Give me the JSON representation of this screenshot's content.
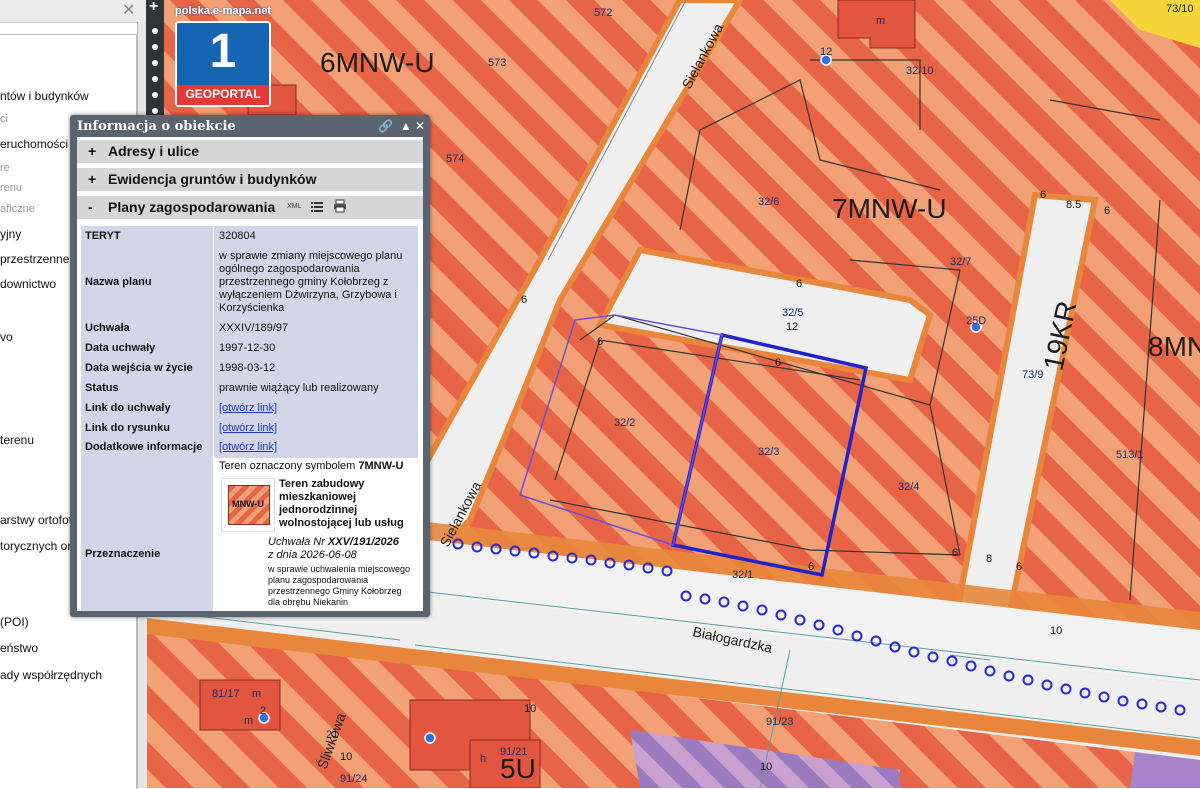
{
  "left_panel": {
    "close_glyph": "✕",
    "items": [
      {
        "label": "ntów i budynków",
        "dim": false
      },
      {
        "label": "ci",
        "dim": true
      },
      {
        "label": "eruchomości",
        "dim": false
      },
      {
        "label": "re",
        "dim": true
      },
      {
        "label": "renu",
        "dim": true
      },
      {
        "label": "aficzne",
        "dim": true
      },
      {
        "label": "yjny",
        "dim": false
      },
      {
        "label": "przestrzenne",
        "dim": false
      },
      {
        "label": "downictwo",
        "dim": false
      },
      {
        "label": "vo",
        "dim": false
      },
      {
        "label": "terenu",
        "dim": false
      },
      {
        "label": "arstwy ortofot",
        "dim": false
      },
      {
        "label": "torycznych or",
        "dim": false
      },
      {
        "label": "(POI)",
        "dim": false
      },
      {
        "label": "eństwo",
        "dim": false
      },
      {
        "label": "ady współrzędnych",
        "dim": false
      }
    ]
  },
  "zoom": {
    "plus": "+"
  },
  "logo": {
    "url": "polska.e-mapa.net",
    "number": "1",
    "text": "GEOPORTAL"
  },
  "map": {
    "zones": [
      "6MNW-U",
      "7MNW-U",
      "8MN",
      "19KR",
      "5U"
    ],
    "plots": [
      "572",
      "573",
      "574",
      "32/10",
      "32/6",
      "32/7",
      "32/5",
      "25D",
      "73/9",
      "32/2",
      "32/3",
      "32/4",
      "513/1",
      "32/1",
      "73/10",
      "12",
      "81/17",
      "91/23",
      "91/21",
      "91/24",
      "m",
      "m",
      "m",
      "h",
      "2",
      "21"
    ],
    "dims": [
      "6",
      "8.5",
      "6",
      "6",
      "6",
      "6",
      "12",
      "6",
      "6",
      "8",
      "6",
      "10",
      "10",
      "10",
      "10",
      "6"
    ],
    "streets": [
      "Sielankowa",
      "Sielankowa",
      "Białogardzka",
      "Śliwkowa"
    ],
    "colors": {
      "zone_orange": "#f0976a",
      "zone_red": "#e85f43",
      "road": "#efefef",
      "road_edge": "#e8873b",
      "selection": "#2222cc",
      "sidewalk_dots": "#2a2acc"
    }
  },
  "info": {
    "title": "Informacja o obiekcie",
    "controls": {
      "link": "🔗",
      "collapse": "▲",
      "close": "✕"
    },
    "sections": [
      {
        "sign": "+",
        "label": "Adresy i ulice"
      },
      {
        "sign": "+",
        "label": "Ewidencja gruntów i budynków"
      },
      {
        "sign": "-",
        "label": "Plany zagospodarowania",
        "xml": "XML"
      }
    ],
    "rows": {
      "teryt": {
        "k": "TERYT",
        "v": "320804"
      },
      "nazwa": {
        "k": "Nazwa planu",
        "v": "w sprawie zmiany miejscowego planu ogólnego zagospodarowania przestrzennego gminy Kołobrzeg z wyłączeniem Dźwirzyna, Grzybowa i Korzyścienka"
      },
      "uchwala": {
        "k": "Uchwała",
        "v": "XXXIV/189/97"
      },
      "data_uchwaly": {
        "k": "Data uchwały",
        "v": "1997-12-30"
      },
      "data_wejscia": {
        "k": "Data wejścia w życie",
        "v": "1998-03-12"
      },
      "status": {
        "k": "Status",
        "v": "prawnie wiążący lub realizowany"
      },
      "link_uchwaly": {
        "k": "Link do uchwały",
        "v": "[otwórz link]"
      },
      "link_rysunku": {
        "k": "Link do rysunku",
        "v": "[otwórz link]"
      },
      "dodatkowe": {
        "k": "Dodatkowe informacje",
        "v": "[otwórz link]"
      },
      "przeznaczenie": {
        "k": "Przeznaczenie",
        "teren_prefix": "Teren oznaczony symbolem",
        "symbol": "7MNW-U",
        "swatch_label": "MNW-U",
        "swatch_desc": "Teren zabudowy mieszkaniowej jednorodzinnej wolnostojącej lub usług",
        "uchwala_prefix": "Uchwała Nr",
        "uchwala_nr": "XXV/191/2026",
        "data_prefix": "z dnia",
        "data": "2026-06-08",
        "desc": "w sprawie uchwalenia miejscowego planu zagospodarowania przestrzennego Gminy Kołobrzeg dla obrębu Niekanin"
      }
    }
  }
}
